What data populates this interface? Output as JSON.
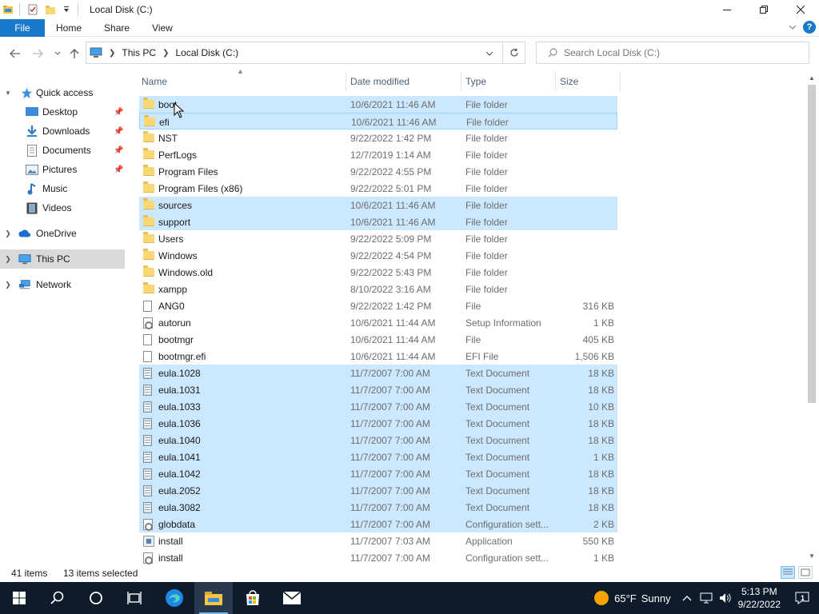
{
  "window": {
    "title": "Local Disk (C:)",
    "quick_access_icons": [
      "explorer-icon",
      "properties-icon",
      "new-folder-icon",
      "customize-dropdown-icon"
    ]
  },
  "ribbon": {
    "tabs": [
      "File",
      "Home",
      "Share",
      "View"
    ]
  },
  "address": {
    "segments": [
      "This PC",
      "Local Disk (C:)"
    ],
    "search_placeholder": "Search Local Disk (C:)"
  },
  "nav": {
    "quick_access": "Quick access",
    "pinned": [
      {
        "label": "Desktop",
        "icon": "desktop-icon",
        "pinned": true
      },
      {
        "label": "Downloads",
        "icon": "downloads-icon",
        "pinned": true
      },
      {
        "label": "Documents",
        "icon": "documents-icon",
        "pinned": true
      },
      {
        "label": "Pictures",
        "icon": "pictures-icon",
        "pinned": true
      },
      {
        "label": "Music",
        "icon": "music-icon",
        "pinned": false
      },
      {
        "label": "Videos",
        "icon": "videos-icon",
        "pinned": false
      }
    ],
    "onedrive": "OneDrive",
    "this_pc": "This PC",
    "network": "Network"
  },
  "columns": [
    "Name",
    "Date modified",
    "Type",
    "Size"
  ],
  "files": [
    {
      "name": "boot",
      "date": "10/6/2021 11:46 AM",
      "type": "File folder",
      "size": "",
      "icon": "folder",
      "state": "sel"
    },
    {
      "name": "efi",
      "date": "10/6/2021 11:46 AM",
      "type": "File folder",
      "size": "",
      "icon": "folder",
      "state": "focus"
    },
    {
      "name": "NST",
      "date": "9/22/2022 1:42 PM",
      "type": "File folder",
      "size": "",
      "icon": "folder",
      "state": ""
    },
    {
      "name": "PerfLogs",
      "date": "12/7/2019 1:14 AM",
      "type": "File folder",
      "size": "",
      "icon": "folder",
      "state": ""
    },
    {
      "name": "Program Files",
      "date": "9/22/2022 4:55 PM",
      "type": "File folder",
      "size": "",
      "icon": "folder",
      "state": ""
    },
    {
      "name": "Program Files (x86)",
      "date": "9/22/2022 5:01 PM",
      "type": "File folder",
      "size": "",
      "icon": "folder",
      "state": ""
    },
    {
      "name": "sources",
      "date": "10/6/2021 11:46 AM",
      "type": "File folder",
      "size": "",
      "icon": "folder",
      "state": "sel"
    },
    {
      "name": "support",
      "date": "10/6/2021 11:46 AM",
      "type": "File folder",
      "size": "",
      "icon": "folder",
      "state": "sel"
    },
    {
      "name": "Users",
      "date": "9/22/2022 5:09 PM",
      "type": "File folder",
      "size": "",
      "icon": "folder",
      "state": ""
    },
    {
      "name": "Windows",
      "date": "9/22/2022 4:54 PM",
      "type": "File folder",
      "size": "",
      "icon": "folder",
      "state": ""
    },
    {
      "name": "Windows.old",
      "date": "9/22/2022 5:43 PM",
      "type": "File folder",
      "size": "",
      "icon": "folder",
      "state": ""
    },
    {
      "name": "xampp",
      "date": "8/10/2022 3:16 AM",
      "type": "File folder",
      "size": "",
      "icon": "folder",
      "state": ""
    },
    {
      "name": "ANG0",
      "date": "9/22/2022 1:42 PM",
      "type": "File",
      "size": "316 KB",
      "icon": "file",
      "state": ""
    },
    {
      "name": "autorun",
      "date": "10/6/2021 11:44 AM",
      "type": "Setup Information",
      "size": "1 KB",
      "icon": "cfg",
      "state": ""
    },
    {
      "name": "bootmgr",
      "date": "10/6/2021 11:44 AM",
      "type": "File",
      "size": "405 KB",
      "icon": "file",
      "state": ""
    },
    {
      "name": "bootmgr.efi",
      "date": "10/6/2021 11:44 AM",
      "type": "EFI File",
      "size": "1,506 KB",
      "icon": "file",
      "state": ""
    },
    {
      "name": "eula.1028",
      "date": "11/7/2007 7:00 AM",
      "type": "Text Document",
      "size": "18 KB",
      "icon": "text",
      "state": "sel"
    },
    {
      "name": "eula.1031",
      "date": "11/7/2007 7:00 AM",
      "type": "Text Document",
      "size": "18 KB",
      "icon": "text",
      "state": "sel"
    },
    {
      "name": "eula.1033",
      "date": "11/7/2007 7:00 AM",
      "type": "Text Document",
      "size": "10 KB",
      "icon": "text",
      "state": "sel"
    },
    {
      "name": "eula.1036",
      "date": "11/7/2007 7:00 AM",
      "type": "Text Document",
      "size": "18 KB",
      "icon": "text",
      "state": "sel"
    },
    {
      "name": "eula.1040",
      "date": "11/7/2007 7:00 AM",
      "type": "Text Document",
      "size": "18 KB",
      "icon": "text",
      "state": "sel"
    },
    {
      "name": "eula.1041",
      "date": "11/7/2007 7:00 AM",
      "type": "Text Document",
      "size": "1 KB",
      "icon": "text",
      "state": "sel"
    },
    {
      "name": "eula.1042",
      "date": "11/7/2007 7:00 AM",
      "type": "Text Document",
      "size": "18 KB",
      "icon": "text",
      "state": "sel"
    },
    {
      "name": "eula.2052",
      "date": "11/7/2007 7:00 AM",
      "type": "Text Document",
      "size": "18 KB",
      "icon": "text",
      "state": "sel"
    },
    {
      "name": "eula.3082",
      "date": "11/7/2007 7:00 AM",
      "type": "Text Document",
      "size": "18 KB",
      "icon": "text",
      "state": "sel"
    },
    {
      "name": "globdata",
      "date": "11/7/2007 7:00 AM",
      "type": "Configuration sett...",
      "size": "2 KB",
      "icon": "cfg",
      "state": "sel"
    },
    {
      "name": "install",
      "date": "11/7/2007 7:03 AM",
      "type": "Application",
      "size": "550 KB",
      "icon": "app",
      "state": ""
    },
    {
      "name": "install",
      "date": "11/7/2007 7:00 AM",
      "type": "Configuration sett...",
      "size": "1 KB",
      "icon": "cfg",
      "state": ""
    }
  ],
  "status": {
    "item_count": "41 items",
    "selected_count": "13 items selected"
  },
  "taskbar": {
    "weather_temp": "65°F",
    "weather_desc": "Sunny",
    "time": "5:13 PM",
    "date": "9/22/2022",
    "notification_count": "1"
  },
  "colors": {
    "accent": "#1979ca",
    "selection": "#cce8ff",
    "taskbar": "#0d1b2a"
  }
}
